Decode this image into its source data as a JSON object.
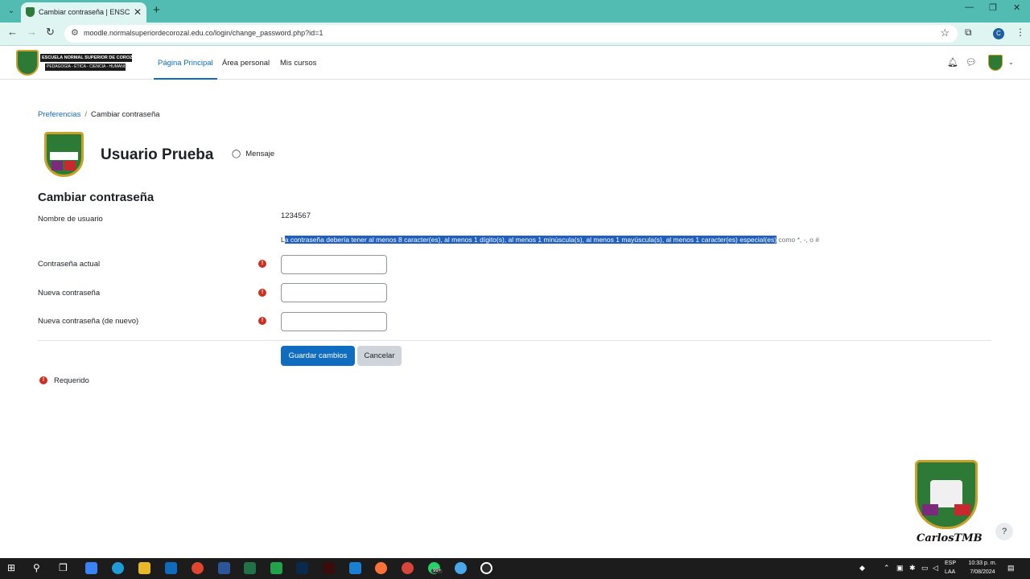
{
  "browser": {
    "tab_title": "Cambiar contraseña | ENSC",
    "tab_close": "✕",
    "new_tab": "+",
    "url": "moodle.normalsuperiordecorozal.edu.co/login/change_password.php?id=1",
    "window_controls": [
      "—",
      "❐",
      "✕"
    ],
    "profile_initial": "C"
  },
  "site": {
    "logo_line1": "ESCUELA NORMAL SUPERIOR DE COROZAL",
    "logo_line2": "PEDAGOGÍA - ÉTICA - CIENCIA - HUMANISMO",
    "nav": [
      "Página Principal",
      "Área personal",
      "Mis cursos"
    ]
  },
  "breadcrumb": {
    "parent": "Preferencias",
    "separator": "/",
    "current": "Cambiar contraseña"
  },
  "profile": {
    "name": "Usuario Prueba",
    "message_label": "Mensaje"
  },
  "form": {
    "heading": "Cambiar contraseña",
    "username_label": "Nombre de usuario",
    "username_value": "1234567",
    "policy_first": "L",
    "policy_selected": "a contraseña debería tener al menos 8 caracter(es), al menos 1 dígito(s), al menos 1 minúscula(s), al menos 1 mayúscula(s), al menos 1 caracter(es) especial(es)",
    "policy_rest": " como *, -, o #",
    "current_label": "Contraseña actual",
    "new_label": "Nueva contraseña",
    "repeat_label": "Nueva contraseña (de nuevo)",
    "save_label": "Guardar cambios",
    "cancel_label": "Cancelar",
    "required_icon": "!",
    "required_label": "Requerido"
  },
  "watermark": {
    "signature": "CarlosTMB"
  },
  "help_label": "?",
  "taskbar": {
    "lang_line1": "ESP",
    "lang_line2": "LAA",
    "time": "10:33 p. m.",
    "date": "7/08/2024",
    "badge": "99+"
  }
}
